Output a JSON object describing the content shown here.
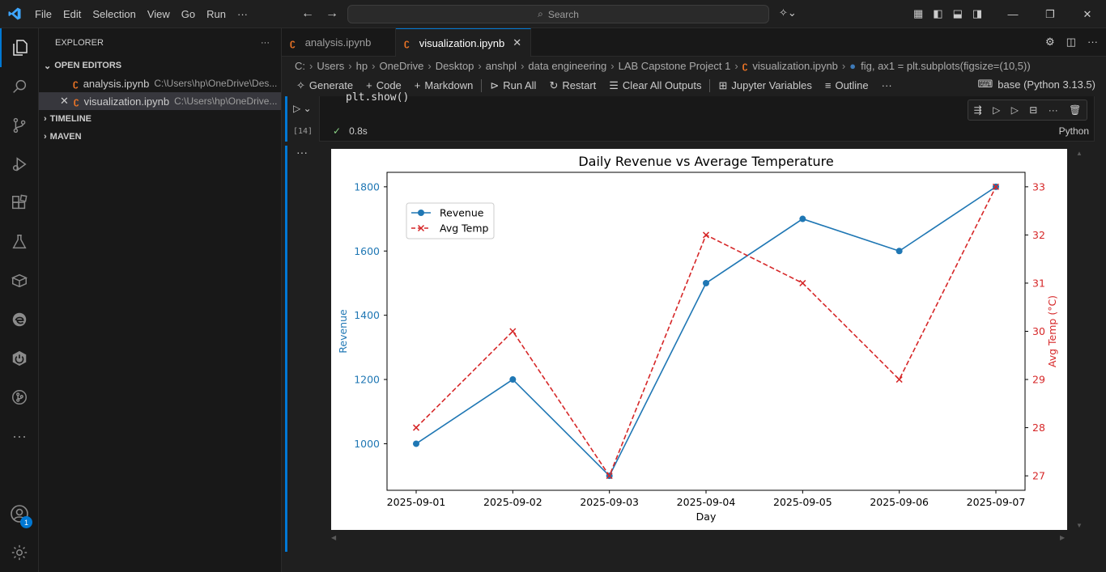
{
  "menu": {
    "items": [
      "File",
      "Edit",
      "Selection",
      "View",
      "Go",
      "Run",
      "···"
    ]
  },
  "search": {
    "placeholder": "Search"
  },
  "sidebar": {
    "title": "EXPLORER",
    "open_editors_label": "OPEN EDITORS",
    "open_editors": [
      {
        "name": "analysis.ipynb",
        "path": "C:\\Users\\hp\\OneDrive\\Des..."
      },
      {
        "name": "visualization.ipynb",
        "path": "C:\\Users\\hp\\OneDrive..."
      }
    ],
    "timeline_label": "TIMELINE",
    "maven_label": "MAVEN"
  },
  "activity": {
    "account_badge": "1"
  },
  "tabs": [
    {
      "label": "analysis.ipynb"
    },
    {
      "label": "visualization.ipynb"
    }
  ],
  "breadcrumb": [
    "C:",
    "Users",
    "hp",
    "OneDrive",
    "Desktop",
    "anshpl",
    "data engineering",
    "LAB Capstone Project 1",
    "visualization.ipynb",
    "fig, ax1 = plt.subplots(figsize=(10,5))"
  ],
  "toolbar": {
    "generate": "Generate",
    "code": "Code",
    "markdown": "Markdown",
    "run_all": "Run All",
    "restart": "Restart",
    "clear_outputs": "Clear All Outputs",
    "variables": "Jupyter Variables",
    "outline": "Outline",
    "kernel": "base (Python 3.13.5)"
  },
  "cell": {
    "code_line": "plt.show()",
    "exec_count": "[14]",
    "duration": "0.8s",
    "language": "Python"
  },
  "chart_data": {
    "type": "line",
    "title": "Daily Revenue vs Average Temperature",
    "xlabel": "Day",
    "ylabel": "Revenue",
    "ylabel_right": "Avg Temp (°C)",
    "categories": [
      "2025-09-01",
      "2025-09-02",
      "2025-09-03",
      "2025-09-04",
      "2025-09-05",
      "2025-09-06",
      "2025-09-07"
    ],
    "series": [
      {
        "name": "Revenue",
        "axis": "left",
        "values": [
          1000,
          1200,
          900,
          1500,
          1700,
          1600,
          1800
        ],
        "color": "#1f77b4",
        "marker": "o",
        "linestyle": "solid"
      },
      {
        "name": "Avg Temp",
        "axis": "right",
        "values": [
          28,
          30,
          27,
          32,
          31,
          29,
          33
        ],
        "color": "#d62728",
        "marker": "x",
        "linestyle": "dashed"
      }
    ],
    "ylim": [
      855,
      1845
    ],
    "ylim_right": [
      26.7,
      33.3
    ],
    "yticks": [
      1000,
      1200,
      1400,
      1600,
      1800
    ],
    "yticks_right": [
      27,
      28,
      29,
      30,
      31,
      32,
      33
    ],
    "legend": "upper-left",
    "grid": false
  }
}
